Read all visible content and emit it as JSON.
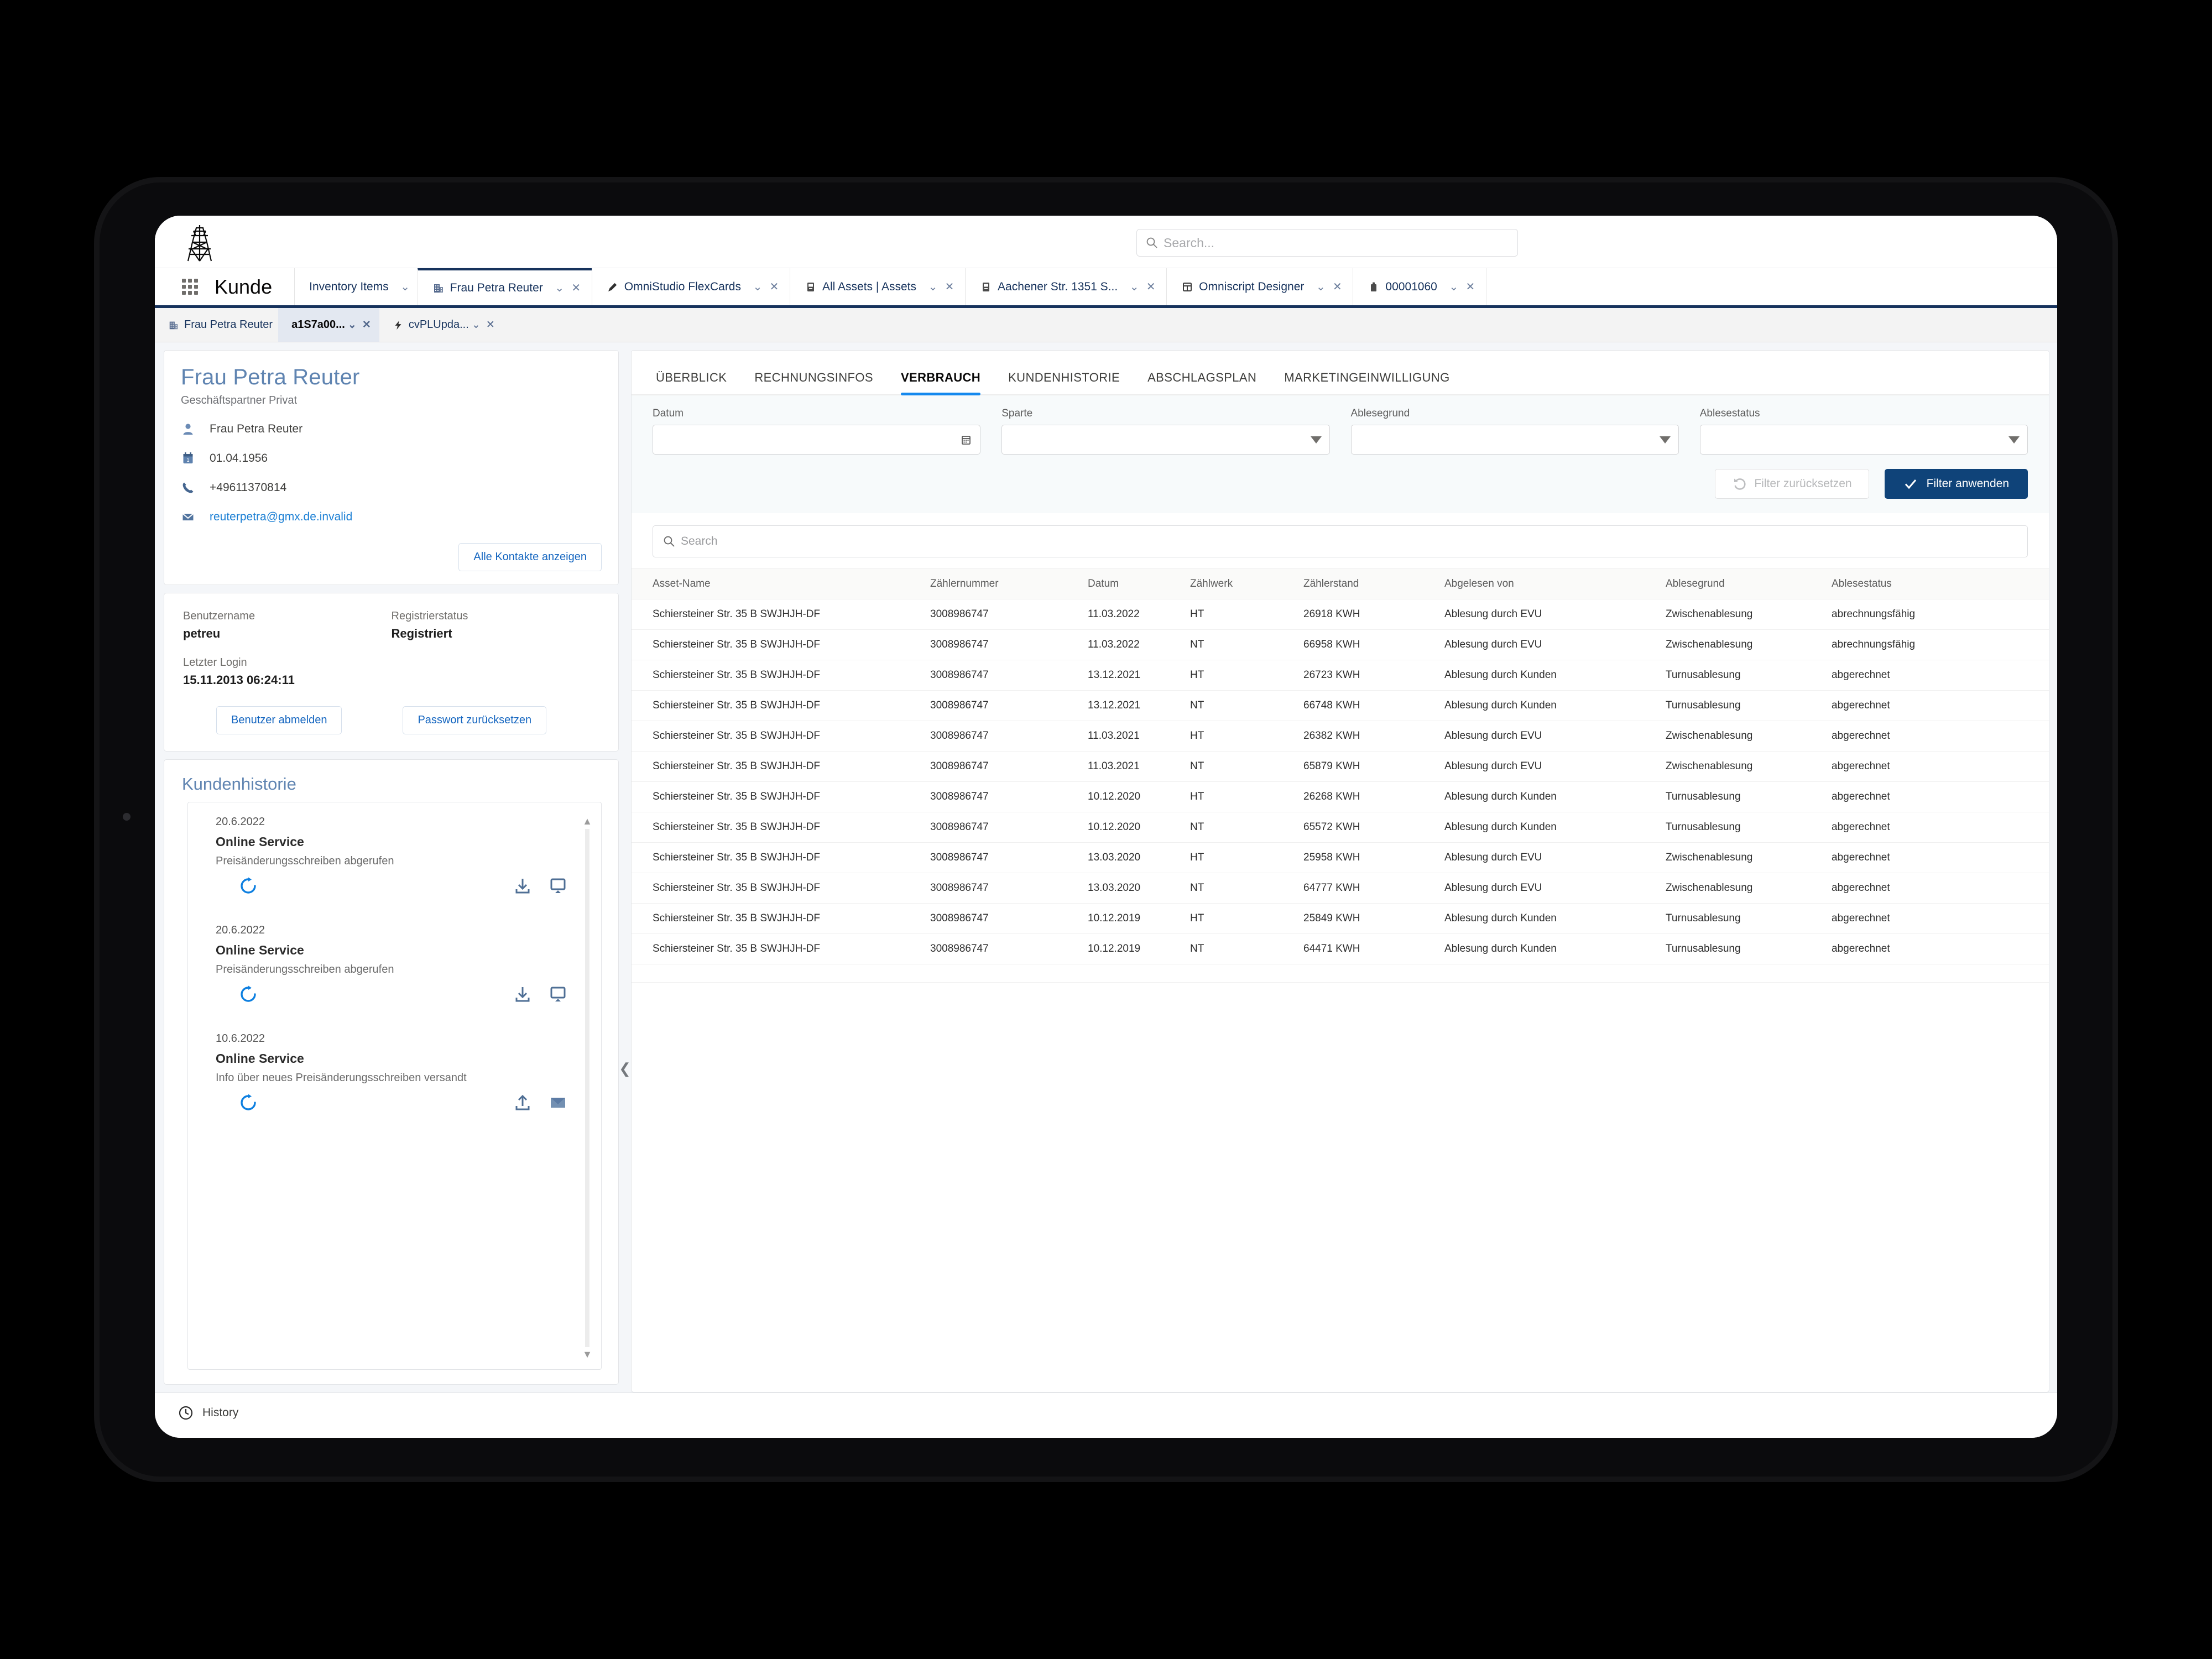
{
  "header": {
    "logo": "power-tower-logo",
    "search_placeholder": "Search..."
  },
  "app_nav": {
    "app_name": "Kunde",
    "tabs": [
      {
        "label": "Inventory Items",
        "icon": "none",
        "active": false,
        "has_chevron": true,
        "has_close": false
      },
      {
        "label": "Frau Petra Reuter",
        "icon": "building-icon",
        "active": true,
        "has_chevron": true,
        "has_close": true
      },
      {
        "label": "OmniStudio FlexCards",
        "icon": "pencil-icon",
        "active": false,
        "has_chevron": true,
        "has_close": true
      },
      {
        "label": "All Assets | Assets",
        "icon": "asset-icon",
        "active": false,
        "has_chevron": true,
        "has_close": true
      },
      {
        "label": "Aachener Str. 1351 S...",
        "icon": "asset-icon",
        "active": false,
        "has_chevron": true,
        "has_close": true
      },
      {
        "label": "Omniscript Designer",
        "icon": "layout-icon",
        "active": false,
        "has_chevron": true,
        "has_close": true
      },
      {
        "label": "00001060",
        "icon": "case-icon",
        "active": false,
        "has_chevron": true,
        "has_close": true
      }
    ]
  },
  "sub_tabs": [
    {
      "label": "Frau Petra Reuter",
      "icon": "building-icon",
      "current": false,
      "has_chevron": false,
      "has_close": false
    },
    {
      "label": "a1S7a00...",
      "icon": "none",
      "current": true,
      "has_chevron": true,
      "has_close": true
    },
    {
      "label": "cvPLUpda...",
      "icon": "lightning-icon",
      "current": false,
      "has_chevron": true,
      "has_close": true
    }
  ],
  "profile": {
    "name": "Frau Petra Reuter",
    "subtitle": "Geschäftspartner Privat",
    "rows": [
      {
        "icon": "person-icon",
        "value": "Frau Petra Reuter",
        "is_link": false
      },
      {
        "icon": "calendar-icon",
        "value": "01.04.1956",
        "is_link": false
      },
      {
        "icon": "phone-icon",
        "value": "+49611370814",
        "is_link": false
      },
      {
        "icon": "mail-icon",
        "value": "reuterpetra@gmx.de.invalid",
        "is_link": true
      }
    ],
    "all_contacts_button": "Alle Kontakte anzeigen"
  },
  "account": {
    "username_label": "Benutzername",
    "username_value": "petreu",
    "status_label": "Registrierstatus",
    "status_value": "Registriert",
    "last_login_label": "Letzter Login",
    "last_login_value": "15.11.2013 06:24:11",
    "logout_button": "Benutzer abmelden",
    "reset_password_button": "Passwort zurücksetzen"
  },
  "customer_history": {
    "title": "Kundenhistorie",
    "items": [
      {
        "date": "20.6.2022",
        "title": "Online Service",
        "description": "Preisänderungsschreiben abgerufen",
        "left_icon": "refresh-icon",
        "right_icons": [
          "download-icon",
          "monitor-icon"
        ]
      },
      {
        "date": "20.6.2022",
        "title": "Online Service",
        "description": "Preisänderungsschreiben abgerufen",
        "left_icon": "refresh-icon",
        "right_icons": [
          "download-icon",
          "monitor-icon"
        ]
      },
      {
        "date": "10.6.2022",
        "title": "Online Service",
        "description": "Info über neues Preisänderungsschreiben versandt",
        "left_icon": "refresh-icon",
        "right_icons": [
          "upload-icon",
          "mail-filled-icon"
        ]
      }
    ]
  },
  "main": {
    "tabs": [
      {
        "label": "ÜBERBLICK",
        "active": false
      },
      {
        "label": "RECHNUNGSINFOS",
        "active": false
      },
      {
        "label": "VERBRAUCH",
        "active": true
      },
      {
        "label": "KUNDENHISTORIE",
        "active": false
      },
      {
        "label": "ABSCHLAGSPLAN",
        "active": false
      },
      {
        "label": "MARKETINGEINWILLIGUNG",
        "active": false
      }
    ],
    "filters": [
      {
        "label": "Datum",
        "value": "",
        "control": "date"
      },
      {
        "label": "Sparte",
        "value": "",
        "control": "select"
      },
      {
        "label": "Ablesegrund",
        "value": "",
        "control": "select"
      },
      {
        "label": "Ablesestatus",
        "value": "",
        "control": "select"
      }
    ],
    "reset_filter_button": "Filter zurücksetzen",
    "apply_filter_button": "Filter anwenden",
    "table_search_placeholder": "Search",
    "table": {
      "columns": [
        "Asset-Name",
        "Zählernummer",
        "Datum",
        "Zählwerk",
        "Zählerstand",
        "Abgelesen von",
        "Ablesegrund",
        "Ablesestatus"
      ],
      "rows": [
        [
          "Schiersteiner Str. 35 B SWJHJH-DF",
          "3008986747",
          "11.03.2022",
          "HT",
          "26918 KWH",
          "Ablesung durch EVU",
          "Zwischenablesung",
          "abrechnungsfähig"
        ],
        [
          "Schiersteiner Str. 35 B SWJHJH-DF",
          "3008986747",
          "11.03.2022",
          "NT",
          "66958 KWH",
          "Ablesung durch EVU",
          "Zwischenablesung",
          "abrechnungsfähig"
        ],
        [
          "Schiersteiner Str. 35 B SWJHJH-DF",
          "3008986747",
          "13.12.2021",
          "HT",
          "26723 KWH",
          "Ablesung durch Kunden",
          "Turnusablesung",
          "abgerechnet"
        ],
        [
          "Schiersteiner Str. 35 B SWJHJH-DF",
          "3008986747",
          "13.12.2021",
          "NT",
          "66748 KWH",
          "Ablesung durch Kunden",
          "Turnusablesung",
          "abgerechnet"
        ],
        [
          "Schiersteiner Str. 35 B SWJHJH-DF",
          "3008986747",
          "11.03.2021",
          "HT",
          "26382 KWH",
          "Ablesung durch EVU",
          "Zwischenablesung",
          "abgerechnet"
        ],
        [
          "Schiersteiner Str. 35 B SWJHJH-DF",
          "3008986747",
          "11.03.2021",
          "NT",
          "65879 KWH",
          "Ablesung durch EVU",
          "Zwischenablesung",
          "abgerechnet"
        ],
        [
          "Schiersteiner Str. 35 B SWJHJH-DF",
          "3008986747",
          "10.12.2020",
          "HT",
          "26268 KWH",
          "Ablesung durch Kunden",
          "Turnusablesung",
          "abgerechnet"
        ],
        [
          "Schiersteiner Str. 35 B SWJHJH-DF",
          "3008986747",
          "10.12.2020",
          "NT",
          "65572 KWH",
          "Ablesung durch Kunden",
          "Turnusablesung",
          "abgerechnet"
        ],
        [
          "Schiersteiner Str. 35 B SWJHJH-DF",
          "3008986747",
          "13.03.2020",
          "HT",
          "25958 KWH",
          "Ablesung durch EVU",
          "Zwischenablesung",
          "abgerechnet"
        ],
        [
          "Schiersteiner Str. 35 B SWJHJH-DF",
          "3008986747",
          "13.03.2020",
          "NT",
          "64777 KWH",
          "Ablesung durch EVU",
          "Zwischenablesung",
          "abgerechnet"
        ],
        [
          "Schiersteiner Str. 35 B SWJHJH-DF",
          "3008986747",
          "10.12.2019",
          "HT",
          "25849 KWH",
          "Ablesung durch Kunden",
          "Turnusablesung",
          "abgerechnet"
        ],
        [
          "Schiersteiner Str. 35 B SWJHJH-DF",
          "3008986747",
          "10.12.2019",
          "NT",
          "64471 KWH",
          "Ablesung durch Kunden",
          "Turnusablesung",
          "abgerechnet"
        ]
      ]
    }
  },
  "footer": {
    "history_label": "History",
    "history_icon": "clock-icon"
  },
  "colors": {
    "brand_navy": "#16325c",
    "accent_blue": "#1589ee",
    "link_blue": "#1b7fd4",
    "apply_button": "#0f4379",
    "heading_blue": "#5f84b1"
  }
}
